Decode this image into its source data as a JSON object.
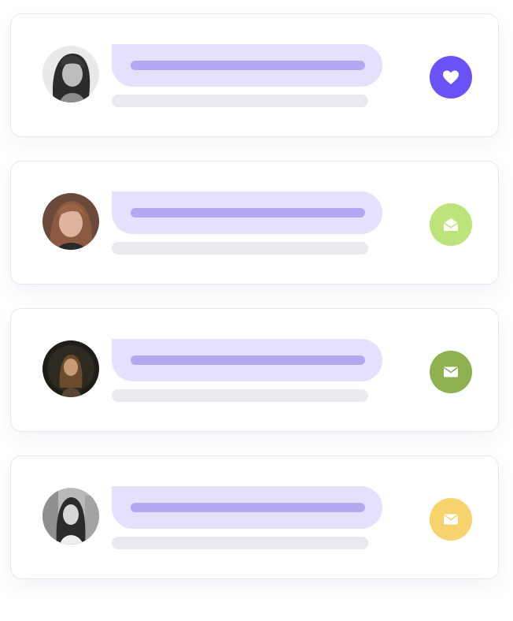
{
  "cards": [
    {
      "avatar": "woman-portrait-grayscale",
      "action_icon": "heart-icon",
      "action_color": "#6a53f6"
    },
    {
      "avatar": "woman-portrait-color",
      "action_icon": "envelope-open-icon",
      "action_color": "#bde37b"
    },
    {
      "avatar": "woman-portrait-dark",
      "action_icon": "envelope-icon",
      "action_color": "#8fb04e"
    },
    {
      "avatar": "woman-portrait-grayscale",
      "action_icon": "envelope-icon",
      "action_color": "#f7d36e"
    }
  ],
  "colors": {
    "bubble_bg": "#e4e1fd",
    "bubble_line": "#b3a8f1",
    "subline": "#e9eaee",
    "card_border": "#e6e8f0"
  }
}
